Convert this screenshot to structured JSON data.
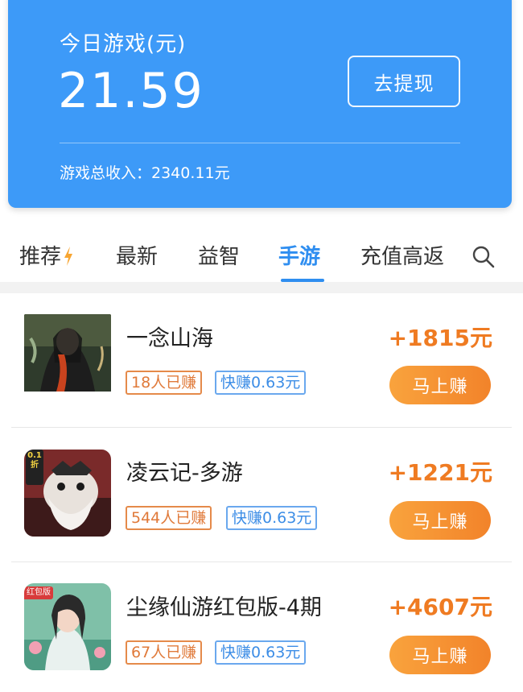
{
  "header": {
    "today_label": "今日游戏(元)",
    "today_amount": "21.59",
    "withdraw_label": "去提现",
    "total_income": "游戏总收入：2340.11元",
    "bg_color": "#3d9af8"
  },
  "tabs": [
    {
      "label": "推荐",
      "icon": "bolt-icon",
      "active": false
    },
    {
      "label": "最新",
      "active": false
    },
    {
      "label": "益智",
      "active": false
    },
    {
      "label": "手游",
      "active": true
    },
    {
      "label": "充值高返",
      "active": false
    }
  ],
  "search_icon": "search-icon",
  "games": [
    {
      "title": "一念山海",
      "earned_badge": "18人已赚",
      "quick_badge": "快赚0.63元",
      "reward": "+1815元",
      "button_label": "马上赚"
    },
    {
      "title": "凌云记-多游",
      "earned_badge": "544人已赚",
      "quick_badge": "快赚0.63元",
      "reward": "+1221元",
      "button_label": "马上赚",
      "thumb_tag": "0.1折"
    },
    {
      "title": "尘缘仙游红包版-4期",
      "earned_badge": "67人已赚",
      "quick_badge": "快赚0.63元",
      "reward": "+4607元",
      "button_label": "马上赚",
      "thumb_tag": "红包版"
    }
  ],
  "colors": {
    "accent_blue": "#2f8ef0",
    "reward_orange": "#ef7b22",
    "button_orange": "#f2832a"
  }
}
